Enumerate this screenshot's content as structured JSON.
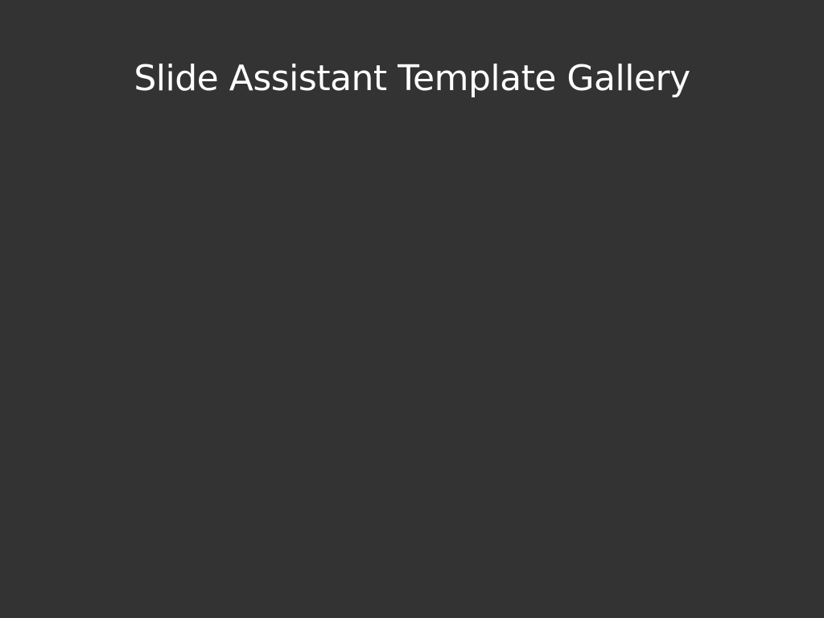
{
  "slide": {
    "title": "Slide Assistant Template Gallery",
    "background_color": "#333333",
    "title_color": "#ffffff"
  }
}
